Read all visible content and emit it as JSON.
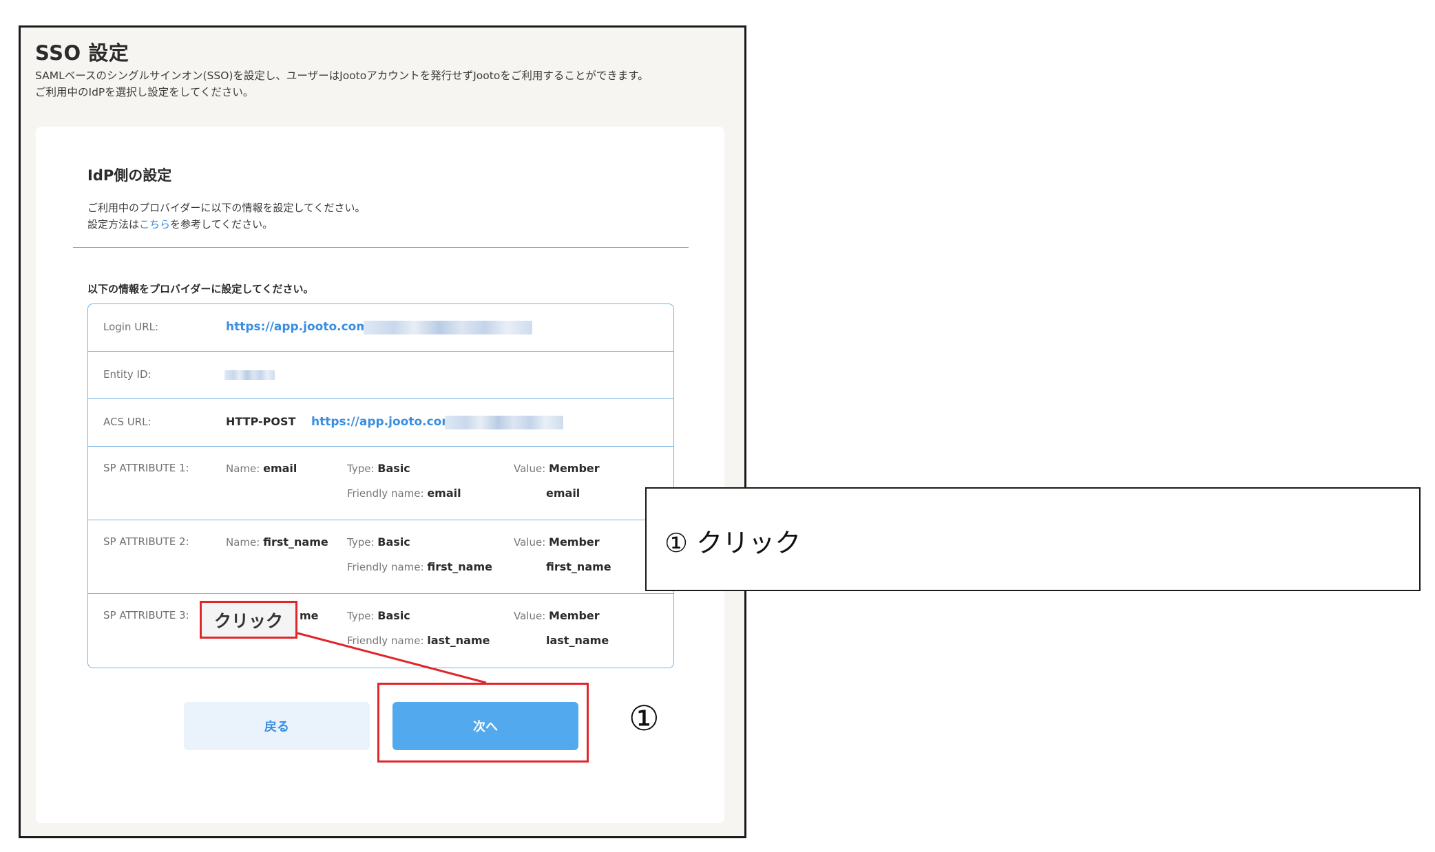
{
  "page": {
    "title": "SSO 設定",
    "description_line1": "SAMLベースのシングルサインオン(SSO)を設定し、ユーザーはJootoアカウントを発行せずJootoをご利用することができます。",
    "description_line2": "ご利用中のIdPを選択し設定をしてください。"
  },
  "idp": {
    "title": "IdP側の設定",
    "intro_line1": "ご利用中のプロバイダーに以下の情報を設定してください。",
    "intro_line2_prefix": "設定方法は",
    "intro_link": "こちら",
    "intro_line2_suffix": "を参考してください。",
    "info_heading": "以下の情報をプロバイダーに設定してください。"
  },
  "table": {
    "login_url_label": "Login URL:",
    "login_url_value": "https://app.jooto.com/",
    "entity_id_label": "Entity ID:",
    "acs_url_label": "ACS URL:",
    "acs_method": "HTTP-POST",
    "acs_url_value": "https://app.jooto.com",
    "name_label": "Name:",
    "type_label": "Type:",
    "friendly_label": "Friendly name:",
    "value_label": "Value:",
    "attributes": [
      {
        "label": "SP ATTRIBUTE 1:",
        "name": "email",
        "type": "Basic",
        "friendly_name": "email",
        "value_line1": "Member",
        "value_line2": "email"
      },
      {
        "label": "SP ATTRIBUTE 2:",
        "name": "first_name",
        "type": "Basic",
        "friendly_name": "first_name",
        "value_line1": "Member",
        "value_line2": "first_name"
      },
      {
        "label": "SP ATTRIBUTE 3:",
        "name_partial": "me",
        "type": "Basic",
        "friendly_name": "last_name",
        "value_line1": "Member",
        "value_line2": "last_name"
      }
    ]
  },
  "buttons": {
    "back": "戻る",
    "next": "次へ"
  },
  "annotation": {
    "callout": "クリック",
    "step_number": "①",
    "instruction": "① クリック",
    "highlight_color": "#e0262b"
  },
  "colors": {
    "accent_blue": "#3a8ee0",
    "primary_button": "#52a9ee",
    "table_border": "#6fb3e6",
    "background": "#f7f5f1"
  }
}
